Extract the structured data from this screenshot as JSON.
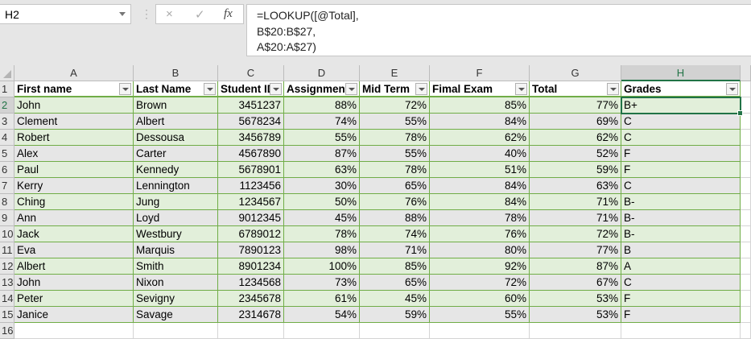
{
  "name_box": "H2",
  "formula_icons": {
    "cancel": "×",
    "enter": "✓",
    "fx": "fx"
  },
  "formula": [
    "=LOOKUP([@Total],",
    "B$20:B$27,",
    "A$20:A$27)"
  ],
  "columns": [
    "A",
    "B",
    "C",
    "D",
    "E",
    "F",
    "G",
    "H"
  ],
  "selected_column": "H",
  "headers": [
    "First name",
    "Last Name",
    "Student ID",
    "Assignment",
    "Mid Term",
    "Fimal Exam",
    "Total",
    "Grades"
  ],
  "rows": [
    [
      "John",
      "Brown",
      "3451237",
      "88%",
      "72%",
      "85%",
      "77%",
      "B+"
    ],
    [
      "Clement",
      "Albert",
      "5678234",
      "74%",
      "55%",
      "84%",
      "69%",
      "C"
    ],
    [
      "Robert",
      "Dessousa",
      "3456789",
      "55%",
      "78%",
      "62%",
      "62%",
      "C"
    ],
    [
      "Alex",
      "Carter",
      "4567890",
      "87%",
      "55%",
      "40%",
      "52%",
      "F"
    ],
    [
      "Paul",
      "Kennedy",
      "5678901",
      "63%",
      "78%",
      "51%",
      "59%",
      "F"
    ],
    [
      "Kerry",
      "Lennington",
      "1123456",
      "30%",
      "65%",
      "84%",
      "63%",
      "C"
    ],
    [
      "Ching",
      "Jung",
      "1234567",
      "50%",
      "76%",
      "84%",
      "71%",
      "B-"
    ],
    [
      "Ann",
      "Loyd",
      "9012345",
      "45%",
      "88%",
      "78%",
      "71%",
      "B-"
    ],
    [
      "Jack",
      "Westbury",
      "6789012",
      "78%",
      "74%",
      "76%",
      "72%",
      "B-"
    ],
    [
      "Eva",
      "Marquis",
      "7890123",
      "98%",
      "71%",
      "80%",
      "77%",
      "B"
    ],
    [
      "Albert",
      "Smith",
      "8901234",
      "100%",
      "85%",
      "92%",
      "87%",
      "A"
    ],
    [
      "John",
      "Nixon",
      "1234568",
      "73%",
      "65%",
      "72%",
      "67%",
      "C"
    ],
    [
      "Peter",
      "Sevigny",
      "2345678",
      "61%",
      "45%",
      "60%",
      "53%",
      "F"
    ],
    [
      "Janice",
      "Savage",
      "2314678",
      "54%",
      "59%",
      "55%",
      "53%",
      "F"
    ]
  ],
  "row_numbers": [
    "1",
    "2",
    "3",
    "4",
    "5",
    "6",
    "7",
    "8",
    "9",
    "10",
    "11",
    "12",
    "13",
    "14",
    "15",
    "16"
  ],
  "colors": {
    "accent": "#217346",
    "band": "#e2efda",
    "table_border": "#70ad47"
  }
}
